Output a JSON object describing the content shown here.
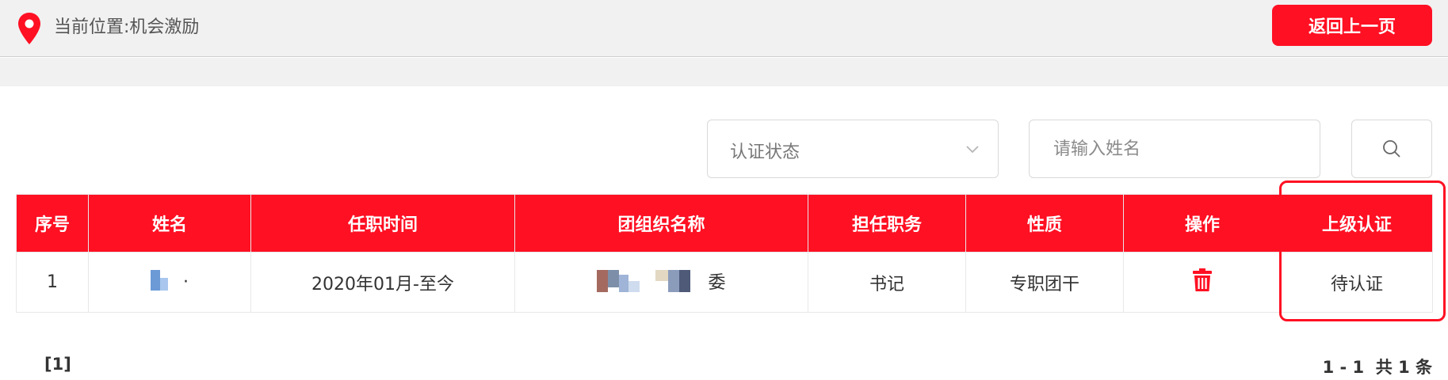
{
  "header": {
    "breadcrumb": "当前位置:机会激励",
    "back_button": "返回上一页"
  },
  "filters": {
    "status_select": {
      "selected": "认证状态"
    },
    "name_input": {
      "placeholder": "请输入姓名",
      "value": ""
    }
  },
  "table": {
    "columns": [
      "序号",
      "姓名",
      "任职时间",
      "团组织名称",
      "担任职务",
      "性质",
      "操作",
      "上级认证"
    ],
    "rows": [
      {
        "index": "1",
        "name": "·",
        "tenure": "2020年01月-至今",
        "org_suffix": "委",
        "position": "书记",
        "nature": "专职团干",
        "status": "待认证"
      }
    ]
  },
  "pagination": {
    "pages": "[1]",
    "range": "1 - 1",
    "total": "共 1 条"
  },
  "colors": {
    "accent": "#ff1023",
    "header_bg": "#f1f1f1"
  }
}
